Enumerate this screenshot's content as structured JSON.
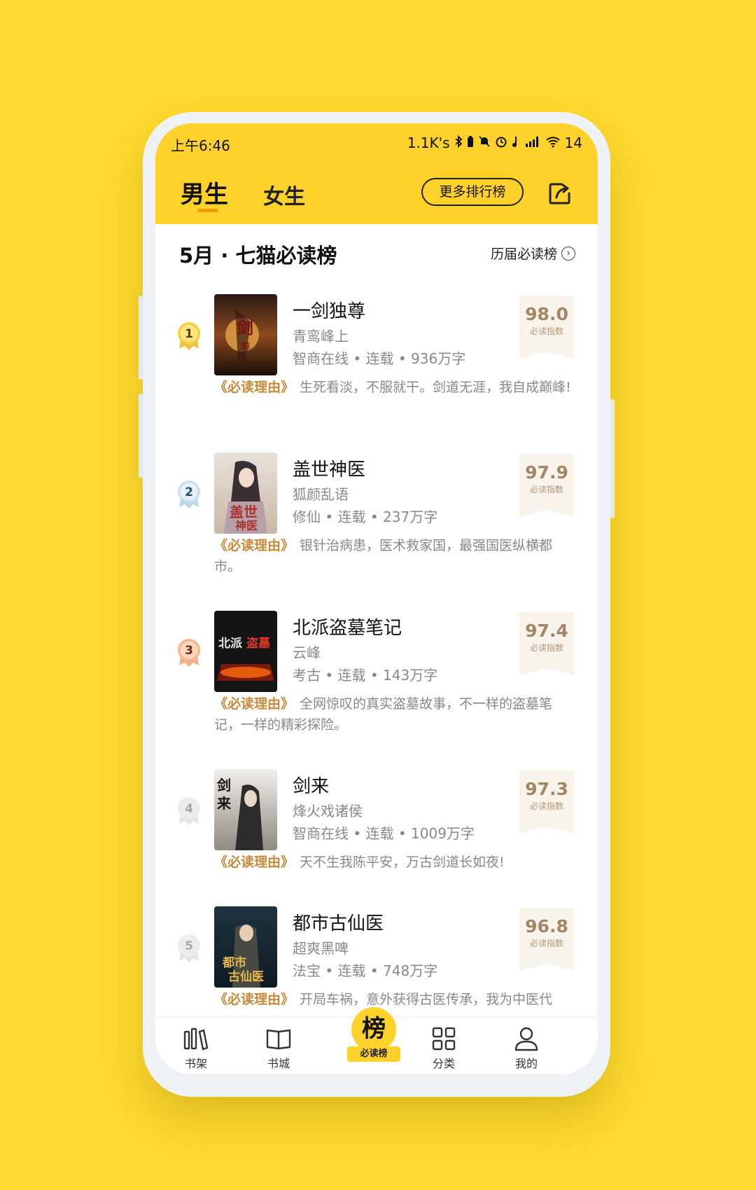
{
  "status_bar": {
    "time": "上午6:46",
    "network_speed": "1.1K's",
    "battery": "14"
  },
  "header": {
    "tab_male": "男生",
    "tab_female": "女生",
    "more_rankings": "更多排行榜"
  },
  "title_bar": {
    "title": "5月 · 七猫必读榜",
    "history_link": "历届必读榜"
  },
  "reason_tag": "《必读理由》",
  "score_label": "必读指数",
  "books": [
    {
      "rank": "1",
      "title": "一剑独尊",
      "author": "青鸾峰上",
      "meta": "智商在线 • 连载 • 936万字",
      "score": "98.0",
      "reason": "生死看淡，不服就干。剑道无涯，我自成巅峰!"
    },
    {
      "rank": "2",
      "title": "盖世神医",
      "author": "狐颜乱语",
      "meta": "修仙 • 连载 • 237万字",
      "score": "97.9",
      "reason": "银针治病患，医术救家国，最强国医纵横都市。"
    },
    {
      "rank": "3",
      "title": "北派盗墓笔记",
      "author": "云峰",
      "meta": "考古 • 连载 • 143万字",
      "score": "97.4",
      "reason": "全网惊叹的真实盗墓故事，不一样的盗墓笔记，一样的精彩探险。"
    },
    {
      "rank": "4",
      "title": "剑来",
      "author": "烽火戏诸侯",
      "meta": "智商在线 • 连载 • 1009万字",
      "score": "97.3",
      "reason": "天不生我陈平安，万古剑道长如夜!"
    },
    {
      "rank": "5",
      "title": "都市古仙医",
      "author": "超爽黑啤",
      "meta": "法宝 • 连载 • 748万字",
      "score": "96.8",
      "reason": "开局车祸，意外获得古医传承，我为中医代"
    }
  ],
  "tabbar": {
    "shelf": "书架",
    "store": "书城",
    "center_char": "榜",
    "center_label": "必读榜",
    "category": "分类",
    "mine": "我的"
  },
  "icons": [
    "signal-icon",
    "wifi-icon",
    "bluetooth-icon",
    "alarm-icon",
    "share-icon",
    "chevron-right-icon",
    "shelf-icon",
    "book-icon",
    "grid-icon",
    "user-icon"
  ],
  "colors": {
    "background": "#fedb2e",
    "header": "#fed22a",
    "score_text": "#a38664",
    "reason_tag": "#c58a3a",
    "underline": "#f39d00"
  }
}
